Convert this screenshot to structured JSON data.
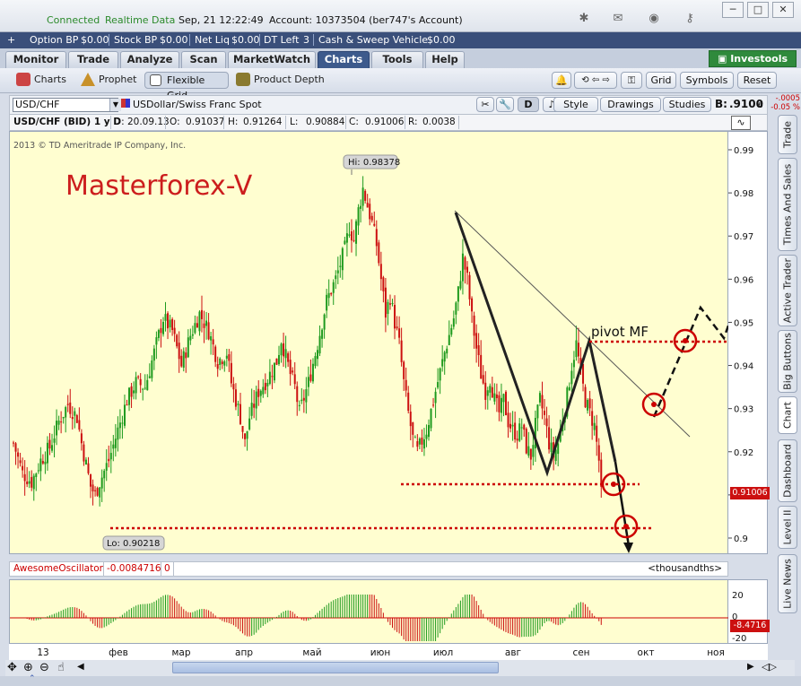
{
  "titlebar": {
    "status": "Connected",
    "data_mode": "Realtime Data",
    "datetime": "Sep, 21  12:22:49",
    "account": "Account: 10373504 (ber747's Account)"
  },
  "account_bar": {
    "option_bp_label": "Option BP",
    "option_bp": "$0.00",
    "stock_bp_label": "Stock BP",
    "stock_bp": "$0.00",
    "net_liq_label": "Net Liq",
    "net_liq": "$0.00",
    "dt_left_label": "DT Left",
    "dt_left": "3",
    "cash_label": "Cash & Sweep Vehicle",
    "cash": "$0.00"
  },
  "tabs": [
    "Monitor",
    "Trade",
    "Analyze",
    "Scan",
    "MarketWatch",
    "Charts",
    "Tools",
    "Help"
  ],
  "investools_label": "Investools",
  "subtabs": {
    "charts": "Charts",
    "prophet": "Prophet",
    "flexible_grid": "Flexible Grid",
    "product_depth": "Product Depth",
    "grid": "Grid",
    "symbols": "Symbols",
    "reset": "Reset"
  },
  "symbol_bar": {
    "symbol": "USD/CHF",
    "description": "USDollar/Swiss Franc Spot",
    "d_label": "D",
    "style": "Style",
    "drawings": "Drawings",
    "studies": "Studies",
    "bid_label": "B:",
    "bid": ".9100",
    "bid_sub": "6",
    "change": "-.0005",
    "change_pct": "-0.05 %"
  },
  "info_bar": {
    "title": "USD/CHF (BID) 1 y D",
    "d": "D: 20.09.13",
    "o_label": "O:",
    "o": "0.91037",
    "h_label": "H:",
    "h": "0.91264",
    "l_label": "L:",
    "l": "0.90884",
    "c_label": "C:",
    "c": "0.91006",
    "r_label": "R:",
    "r": "0.0038"
  },
  "chart": {
    "copyright": "2013 © TD Ameritrade IP Company, Inc.",
    "watermark": "Masterforex-V",
    "hi_label": "Hi: 0.98378",
    "lo_label": "Lo: 0.90218",
    "pivot_label": "pivot MF",
    "price_tag": "0.91006",
    "y_ticks": [
      "0.99",
      "0.98",
      "0.97",
      "0.96",
      "0.95",
      "0.94",
      "0.93",
      "0.92",
      "0.91",
      "0.9"
    ],
    "x_ticks": [
      "13",
      "фев",
      "мар",
      "апр",
      "май",
      "июн",
      "июл",
      "авг",
      "сен",
      "окт",
      "ноя"
    ],
    "colors": {
      "up": "#1e9a1e",
      "down": "#cc1010",
      "background": "#fffed0",
      "annotation": "#cc0000"
    }
  },
  "oscillator": {
    "name": "AwesomeOscillator",
    "value": "-0.0084716",
    "param": "0",
    "units": "<thousandths>",
    "y_ticks": [
      "20",
      "0",
      "-20"
    ],
    "tag": "-8.4716"
  },
  "right_tabs": [
    "Trade",
    "Times And Sales",
    "Active Trader",
    "Big Buttons",
    "Chart",
    "Dashboard",
    "Level II",
    "Live News"
  ],
  "chart_data": {
    "type": "candlestick",
    "symbol": "USD/CHF",
    "title": "USD/CHF (BID) 1 y D",
    "ylim": [
      0.9,
      0.99
    ],
    "x_ticks": [
      "13",
      "фев",
      "мар",
      "апр",
      "май",
      "июн",
      "июл",
      "авг",
      "сен",
      "окт",
      "ноя"
    ],
    "path": [
      [
        0,
        0.922
      ],
      [
        4,
        0.915
      ],
      [
        8,
        0.913
      ],
      [
        12,
        0.918
      ],
      [
        16,
        0.921
      ],
      [
        20,
        0.927
      ],
      [
        24,
        0.931
      ],
      [
        28,
        0.928
      ],
      [
        30,
        0.922
      ],
      [
        34,
        0.912
      ],
      [
        36,
        0.91
      ],
      [
        38,
        0.913
      ],
      [
        42,
        0.918
      ],
      [
        46,
        0.925
      ],
      [
        50,
        0.932
      ],
      [
        54,
        0.936
      ],
      [
        58,
        0.935
      ],
      [
        62,
        0.943
      ],
      [
        66,
        0.951
      ],
      [
        70,
        0.948
      ],
      [
        74,
        0.94
      ],
      [
        78,
        0.947
      ],
      [
        82,
        0.952
      ],
      [
        86,
        0.948
      ],
      [
        90,
        0.941
      ],
      [
        94,
        0.943
      ],
      [
        96,
        0.936
      ],
      [
        100,
        0.928
      ],
      [
        102,
        0.922
      ],
      [
        104,
        0.928
      ],
      [
        108,
        0.934
      ],
      [
        112,
        0.937
      ],
      [
        116,
        0.941
      ],
      [
        118,
        0.946
      ],
      [
        122,
        0.938
      ],
      [
        124,
        0.935
      ],
      [
        126,
        0.929
      ],
      [
        130,
        0.936
      ],
      [
        134,
        0.945
      ],
      [
        138,
        0.955
      ],
      [
        142,
        0.96
      ],
      [
        146,
        0.967
      ],
      [
        148,
        0.972
      ],
      [
        150,
        0.969
      ],
      [
        152,
        0.976
      ],
      [
        154,
        0.981
      ],
      [
        156,
        0.977
      ],
      [
        158,
        0.973
      ],
      [
        160,
        0.968
      ],
      [
        162,
        0.96
      ],
      [
        164,
        0.952
      ],
      [
        166,
        0.956
      ],
      [
        168,
        0.95
      ],
      [
        170,
        0.945
      ],
      [
        172,
        0.936
      ],
      [
        174,
        0.929
      ],
      [
        176,
        0.923
      ],
      [
        178,
        0.92
      ],
      [
        182,
        0.925
      ],
      [
        186,
        0.934
      ],
      [
        190,
        0.943
      ],
      [
        194,
        0.951
      ],
      [
        196,
        0.957
      ],
      [
        198,
        0.965
      ],
      [
        200,
        0.96
      ],
      [
        202,
        0.951
      ],
      [
        204,
        0.944
      ],
      [
        206,
        0.938
      ],
      [
        208,
        0.934
      ],
      [
        210,
        0.937
      ],
      [
        212,
        0.932
      ],
      [
        214,
        0.929
      ],
      [
        216,
        0.932
      ],
      [
        218,
        0.927
      ],
      [
        220,
        0.925
      ],
      [
        222,
        0.924
      ],
      [
        224,
        0.926
      ],
      [
        226,
        0.921
      ],
      [
        228,
        0.919
      ],
      [
        230,
        0.926
      ],
      [
        232,
        0.932
      ],
      [
        234,
        0.928
      ],
      [
        236,
        0.922
      ],
      [
        238,
        0.919
      ],
      [
        240,
        0.922
      ],
      [
        242,
        0.928
      ],
      [
        244,
        0.933
      ],
      [
        246,
        0.94
      ],
      [
        248,
        0.945
      ],
      [
        250,
        0.938
      ],
      [
        252,
        0.932
      ],
      [
        254,
        0.929
      ],
      [
        256,
        0.926
      ],
      [
        258,
        0.918
      ],
      [
        259,
        0.91
      ]
    ],
    "hi": 0.98378,
    "lo": 0.90218,
    "last": 0.91006
  }
}
